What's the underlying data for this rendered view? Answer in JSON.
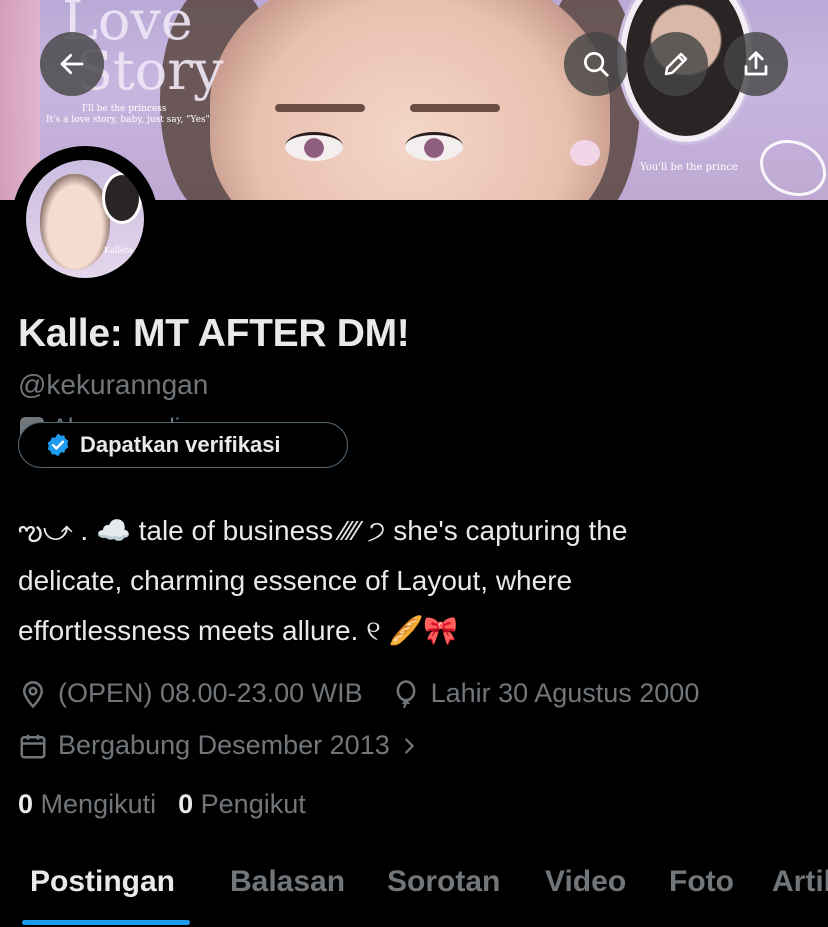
{
  "banner": {
    "title_line1": "Love",
    "title_line2": "Story",
    "tagline1": "I'll be the princess",
    "tagline2": "It's a love story, baby, just say, \"Yes\"",
    "prince_text": "You'll be the prince"
  },
  "avatar": {
    "caption": "Kalleta"
  },
  "profile": {
    "name": "Kalle: MT AFTER DM!",
    "handle": "@kekuranngan",
    "parody_label": "Akun parodi",
    "verify_button": "Dapatkan verifikasi",
    "bio_line1": "ఌ⤻ . ☁️ tale of business ⁄⁄⁄⁄ ੭ she's capturing the",
    "bio_line2": "delicate, charming essence of Layout, where",
    "bio_line3": "effortlessness meets allure. ୧ 🥖🎀",
    "location": "(OPEN) 08.00-23.00 WIB",
    "birthday": "Lahir 30 Agustus 2000",
    "joined": "Bergabung Desember 2013",
    "following_count": "0",
    "following_label": "Mengikuti",
    "followers_count": "0",
    "followers_label": "Pengikut"
  },
  "tabs": [
    "Postingan",
    "Balasan",
    "Sorotan",
    "Video",
    "Foto",
    "Artikel"
  ],
  "colors": {
    "accent": "#1d9bf0",
    "muted": "#71767b",
    "text": "#e7e9ea",
    "background": "#000000"
  },
  "icons": {
    "back": "arrow-left-icon",
    "search": "search-icon",
    "edit": "pencil-icon",
    "share": "share-icon",
    "verified": "verified-badge-icon",
    "location": "location-pin-icon",
    "birthday": "balloon-icon",
    "calendar": "calendar-icon",
    "chevron": "chevron-right-icon",
    "parody": "theater-mask-icon"
  }
}
